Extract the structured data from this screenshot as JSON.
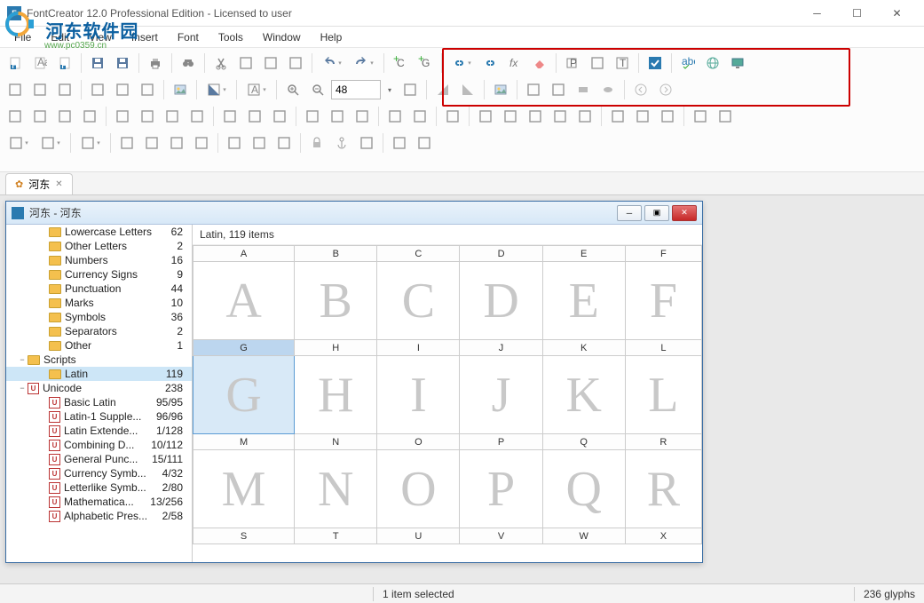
{
  "title": "FontCreator 12.0 Professional Edition - Licensed to user",
  "watermark": {
    "text": "河东软件园",
    "url": "www.pc0359.cn"
  },
  "menus": [
    "File",
    "Edit",
    "View",
    "Insert",
    "Font",
    "Tools",
    "Window",
    "Help"
  ],
  "zoom_value": "48",
  "doc_tab": {
    "label": "河东"
  },
  "child_window": {
    "title": "河东 - 河东"
  },
  "glyph_panel_header": "Latin, 119 items",
  "tree": [
    {
      "indent": 3,
      "type": "folder",
      "label": "Lowercase Letters",
      "count": "62"
    },
    {
      "indent": 3,
      "type": "folder",
      "label": "Other Letters",
      "count": "2"
    },
    {
      "indent": 3,
      "type": "folder",
      "label": "Numbers",
      "count": "16"
    },
    {
      "indent": 3,
      "type": "folder",
      "label": "Currency Signs",
      "count": "9"
    },
    {
      "indent": 3,
      "type": "folder",
      "label": "Punctuation",
      "count": "44"
    },
    {
      "indent": 3,
      "type": "folder",
      "label": "Marks",
      "count": "10"
    },
    {
      "indent": 3,
      "type": "folder",
      "label": "Symbols",
      "count": "36"
    },
    {
      "indent": 3,
      "type": "folder",
      "label": "Separators",
      "count": "2"
    },
    {
      "indent": 3,
      "type": "folder",
      "label": "Other",
      "count": "1"
    },
    {
      "indent": 1,
      "type": "folder",
      "label": "Scripts",
      "count": "",
      "expander": "−"
    },
    {
      "indent": 3,
      "type": "folder",
      "label": "Latin",
      "count": "119",
      "selected": true
    },
    {
      "indent": 1,
      "type": "uni",
      "label": "Unicode",
      "count": "238",
      "expander": "−"
    },
    {
      "indent": 3,
      "type": "uni",
      "label": "Basic Latin",
      "count": "95/95"
    },
    {
      "indent": 3,
      "type": "uni",
      "label": "Latin-1 Supple...",
      "count": "96/96"
    },
    {
      "indent": 3,
      "type": "uni",
      "label": "Latin Extende...",
      "count": "1/128"
    },
    {
      "indent": 3,
      "type": "uni",
      "label": "Combining D...",
      "count": "10/112"
    },
    {
      "indent": 3,
      "type": "uni",
      "label": "General Punc...",
      "count": "15/111"
    },
    {
      "indent": 3,
      "type": "uni",
      "label": "Currency Symb...",
      "count": "4/32"
    },
    {
      "indent": 3,
      "type": "uni",
      "label": "Letterlike Symb...",
      "count": "2/80"
    },
    {
      "indent": 3,
      "type": "uni",
      "label": "Mathematica...",
      "count": "13/256"
    },
    {
      "indent": 3,
      "type": "uni",
      "label": "Alphabetic Pres...",
      "count": "2/58"
    }
  ],
  "glyph_grid": {
    "selected": "G",
    "row1_hdr": [
      "A",
      "B",
      "C",
      "D",
      "E",
      "F"
    ],
    "row1": [
      "A",
      "B",
      "C",
      "D",
      "E",
      "F"
    ],
    "row2_hdr": [
      "G",
      "H",
      "I",
      "J",
      "K",
      "L"
    ],
    "row2": [
      "G",
      "H",
      "I",
      "J",
      "K",
      "L"
    ],
    "row3_hdr": [
      "M",
      "N",
      "O",
      "P",
      "Q",
      "R"
    ],
    "row3": [
      "M",
      "N",
      "O",
      "P",
      "Q",
      "R"
    ],
    "row4_hdr": [
      "S",
      "T",
      "U",
      "V",
      "W",
      "X"
    ]
  },
  "statusbar": {
    "selection": "1 item selected",
    "glyphs": "236 glyphs"
  },
  "icons": {
    "row1": [
      "file-f-icon",
      "file-a-icon",
      "file-p-icon",
      "sep",
      "save-icon",
      "save-all-icon",
      "sep",
      "print-icon",
      "sep",
      "binoculars-icon",
      "sep",
      "scissors-icon",
      "copy-icon",
      "paste-icon",
      "paste-special-icon",
      "sep",
      "undo-icon",
      "undo-dd",
      "redo-icon",
      "redo-dd",
      "hlstart",
      "sep",
      "plus-c-icon",
      "plus-g-icon",
      "sep",
      "link-icon",
      "link-dd",
      "unlink-icon",
      "fx-icon",
      "eraser-icon",
      "sep",
      "p-tag-icon",
      "table-props-icon",
      "t-box-icon",
      "sep",
      "check-icon",
      "sep",
      "abc-spell-icon",
      "globe-grid-icon",
      "monitor-icon",
      "hlend"
    ],
    "row2_left": [
      "rect-select-icon",
      "nudge-right-icon",
      "nudge-up-icon",
      "sep",
      "pointer-icon",
      "pen-icon",
      "freehand-icon",
      "sep",
      "image-edit-icon",
      "sep",
      "fill-half-icon",
      "fill-dd",
      "sep",
      "a-rect-icon",
      "a-rect-dd",
      "sep",
      "zoom-in-icon",
      "zoom-out-icon"
    ],
    "row2_right": [
      "fit-icon",
      "hlstart",
      "sep",
      "corner-tl-icon",
      "corner-bl-icon",
      "sep",
      "image-plus-icon",
      "sep",
      "knife-icon",
      "pencil-icon",
      "rect-solid-icon",
      "ellipse-icon",
      "sep",
      "arrow-left-circle-icon",
      "arrow-right-circle-icon",
      "hlend"
    ],
    "row3": [
      "grid-a-icon",
      "grid-b-icon",
      "grid-c-icon",
      "grid-d-icon",
      "sep",
      "row-top-icon",
      "row-bot-icon",
      "col-left-icon",
      "col-right-icon",
      "sep",
      "align-l-icon",
      "align-c-icon",
      "align-r-icon",
      "sep",
      "align-t-icon",
      "align-m-icon",
      "align-b-icon",
      "sep",
      "dist-h-icon",
      "dist-v-icon",
      "sep",
      "crop-icon",
      "sep",
      "node-a-icon",
      "node-b-icon",
      "node-c-icon",
      "node-d-icon",
      "node-e-icon",
      "sep",
      "merge-a-icon",
      "merge-b-icon",
      "merge-c-icon",
      "sep",
      "layer-a-icon",
      "layer-b-icon"
    ],
    "row4": [
      "panel-a-icon",
      "panel-a-dd",
      "panel-b-icon",
      "panel-b-dd",
      "sep",
      "doc-a-icon",
      "doc-a-dd",
      "sep",
      "tbl-a-icon",
      "tbl-b-icon",
      "tbl-c-icon",
      "tbl-d-icon",
      "sep",
      "grp-a-icon",
      "grp-b-icon",
      "grp-c-icon",
      "sep",
      "lock-icon",
      "anchor-icon",
      "target-icon",
      "sep",
      "shape-a-icon",
      "shape-b-icon"
    ]
  }
}
